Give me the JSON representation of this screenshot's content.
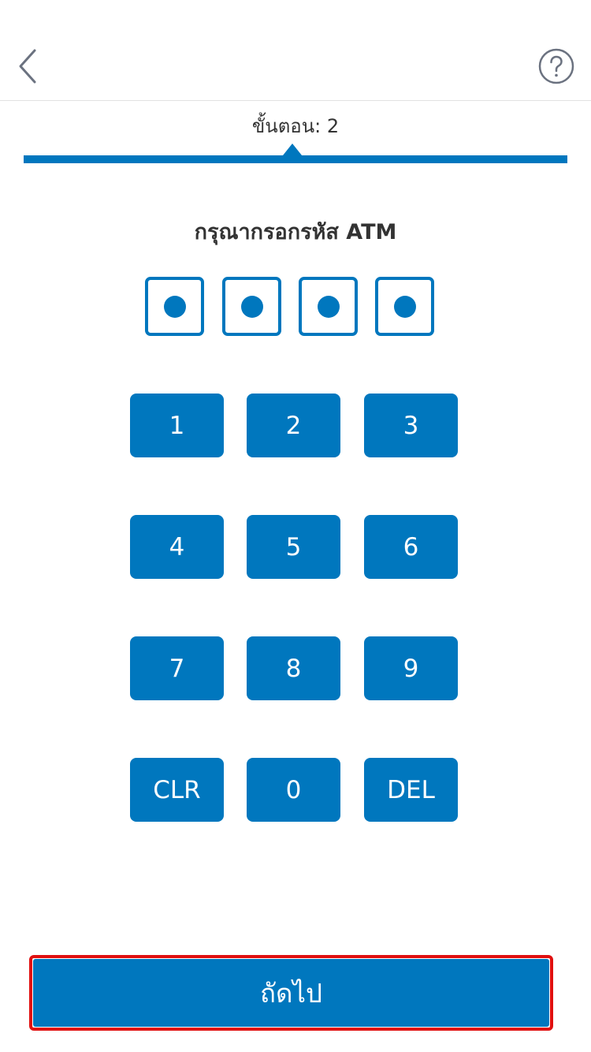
{
  "header": {
    "back_icon": "chevron-left-icon",
    "help_icon": "question-circle-icon",
    "icon_color": "#6b7280"
  },
  "progress": {
    "step_label": "ขั้นตอน: 2",
    "bar_color": "#0077be"
  },
  "prompt": "กรุณากรอกรหัส ATM",
  "pin": {
    "length": 4,
    "filled": 4
  },
  "keypad": {
    "rows": [
      [
        "1",
        "2",
        "3"
      ],
      [
        "4",
        "5",
        "6"
      ],
      [
        "7",
        "8",
        "9"
      ],
      [
        "CLR",
        "0",
        "DEL"
      ]
    ]
  },
  "next_button": {
    "label": "ถัดไป",
    "highlight_color": "#e01010"
  },
  "accent_color": "#0077be"
}
